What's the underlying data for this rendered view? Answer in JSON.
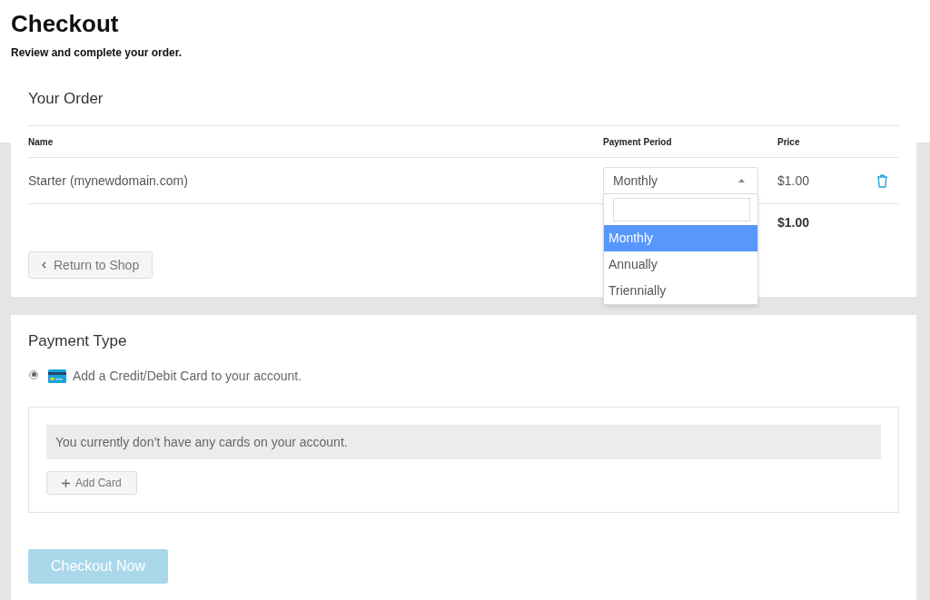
{
  "header": {
    "title": "Checkout",
    "subtitle": "Review and complete your order."
  },
  "order": {
    "heading": "Your Order",
    "columns": [
      "Name",
      "Payment Period",
      "Price"
    ],
    "rows": [
      {
        "name": "Starter (mynewdomain.com)",
        "payment_period": {
          "value": "Monthly",
          "expanded": true,
          "options": [
            {
              "label": "Monthly",
              "selected": true
            },
            {
              "label": "Annually",
              "selected": false
            },
            {
              "label": "Triennially",
              "selected": false
            }
          ]
        },
        "price": "$1.00"
      }
    ],
    "total": "$1.00",
    "return_button": "Return to Shop"
  },
  "payment": {
    "heading": "Payment Type",
    "methods": [
      {
        "label": "Add a Credit/Debit Card to your account.",
        "selected": true
      }
    ],
    "notice": "You currently don’t have any cards on your account.",
    "add_button": "Add Card"
  },
  "checkout_button": {
    "label": "Checkout Now",
    "disabled": true
  }
}
